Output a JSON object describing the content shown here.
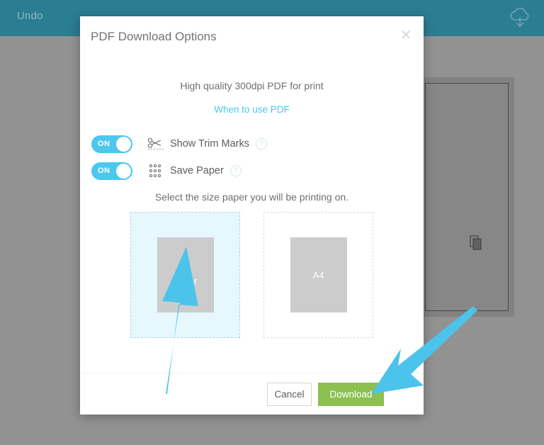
{
  "topbar": {
    "undo_label": "Undo",
    "cloud_icon": "cloud-download-icon",
    "background_color": "#2b7d92"
  },
  "workspace": {
    "copy_icon": "copy-pages-icon",
    "backdrop_color": "#828282"
  },
  "modal": {
    "title": "PDF Download Options",
    "close_icon": "close-icon",
    "quality_text": "High quality 300dpi PDF for print",
    "help_link": "When to use PDF",
    "help_link_color": "#4cc7ee",
    "options": [
      {
        "label": "Show Trim Marks",
        "toggle_state": "ON",
        "icon": "scissors-icon",
        "help_icon": "question-mark-icon"
      },
      {
        "label": "Save Paper",
        "toggle_state": "ON",
        "icon": "dot-grid-icon",
        "help_icon": "question-mark-icon"
      }
    ],
    "toggle_on_color": "#4cc7ee",
    "size_prompt": "Select the size paper you will be printing on.",
    "sizes": [
      {
        "label": "US\nLetter",
        "line1": "US",
        "line2": "Letter",
        "selected": true
      },
      {
        "label": "A4",
        "line1": "A4",
        "line2": "",
        "selected": false
      }
    ],
    "selected_tile_color": "#e6f7fd",
    "footer": {
      "cancel_label": "Cancel",
      "download_label": "Download",
      "download_color": "#8cc152"
    }
  },
  "annotations": {
    "arrow_color": "#4cc3ea",
    "arrow_us_letter": "arrow-pointing-to-us-letter",
    "arrow_download": "arrow-pointing-to-download"
  }
}
